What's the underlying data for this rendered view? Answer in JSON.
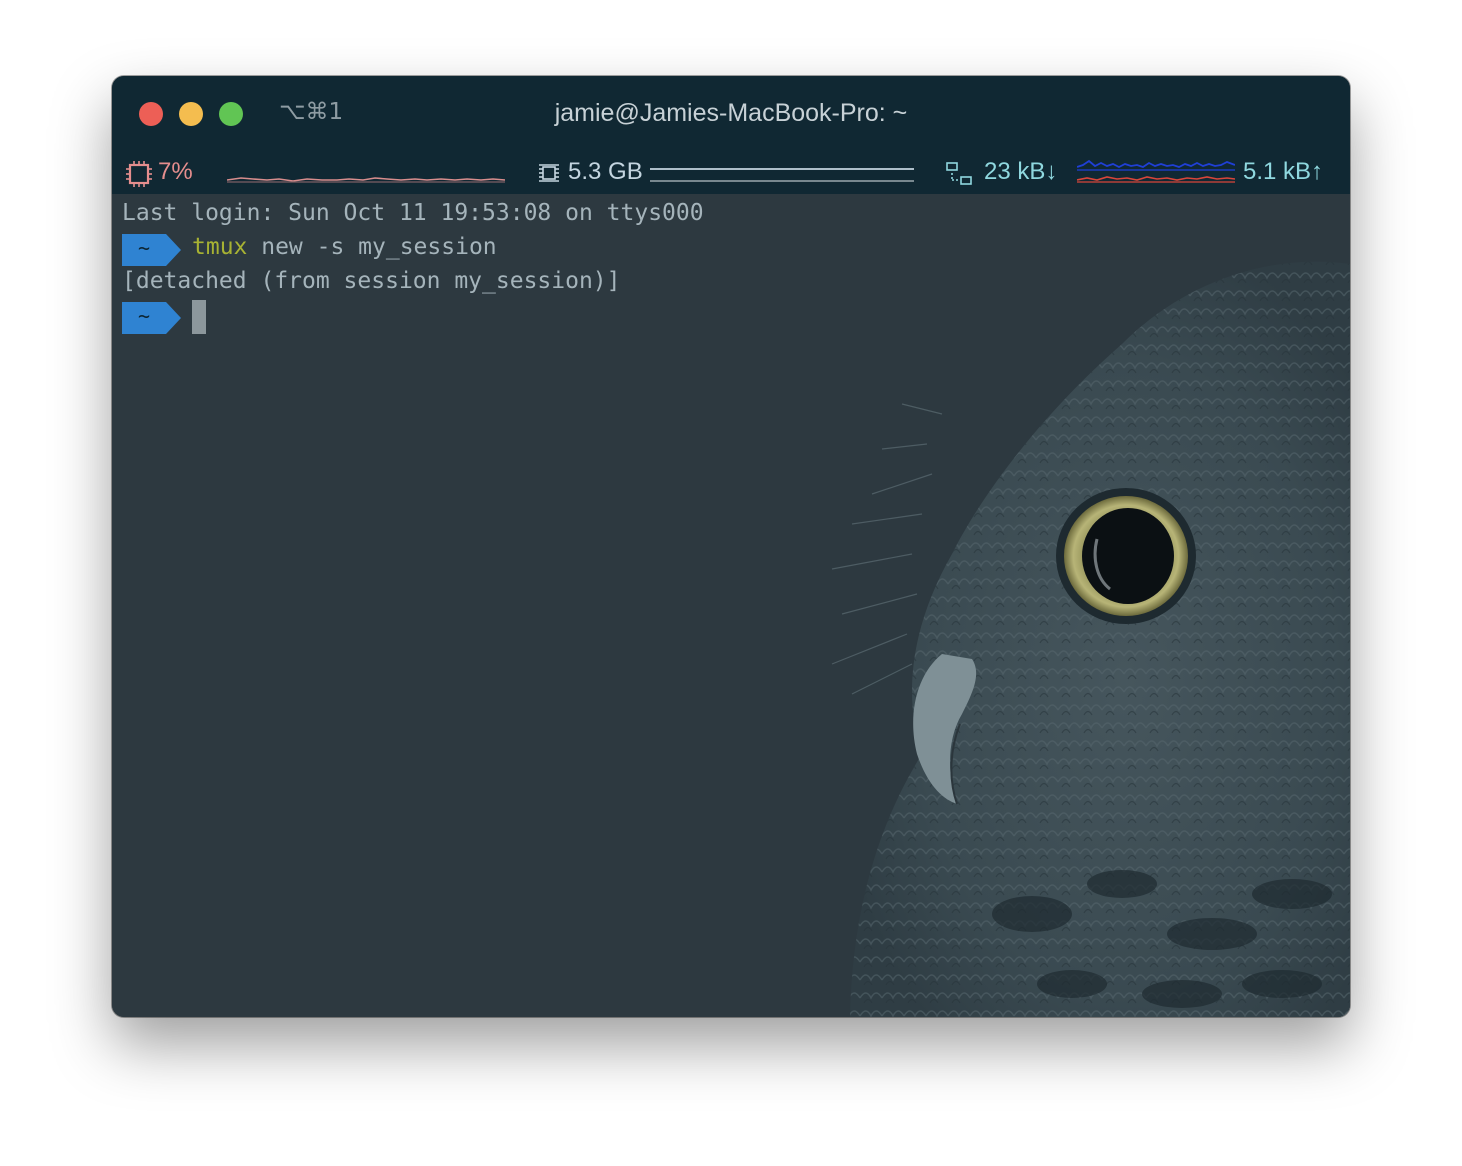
{
  "window": {
    "shortcut": "⌥⌘1",
    "title": "jamie@Jamies-MacBook-Pro: ~"
  },
  "statusbar": {
    "cpu": {
      "icon": "cpu-chip-icon",
      "value": "7%",
      "color": "#e58e8e"
    },
    "memory": {
      "icon": "memory-icon",
      "value": "5.3 GB",
      "color": "#c4d5e0"
    },
    "network": {
      "icon": "network-icon",
      "down": "23 kB↓",
      "up": "5.1 kB↑",
      "down_color": "#1f3fd6",
      "up_color": "#d8453a"
    }
  },
  "terminal": {
    "last_login": "Last login: Sun Oct 11 19:53:08 on ttys000",
    "prompt_symbol": "~",
    "command_name": "tmux",
    "command_args": " new -s my_session",
    "output": "[detached (from session my_session)]"
  },
  "colors": {
    "titlebar": "#102833",
    "terminal_bg": "#2d3940",
    "prompt_bg": "#2f83d2",
    "command_highlight": "#a7b233"
  }
}
